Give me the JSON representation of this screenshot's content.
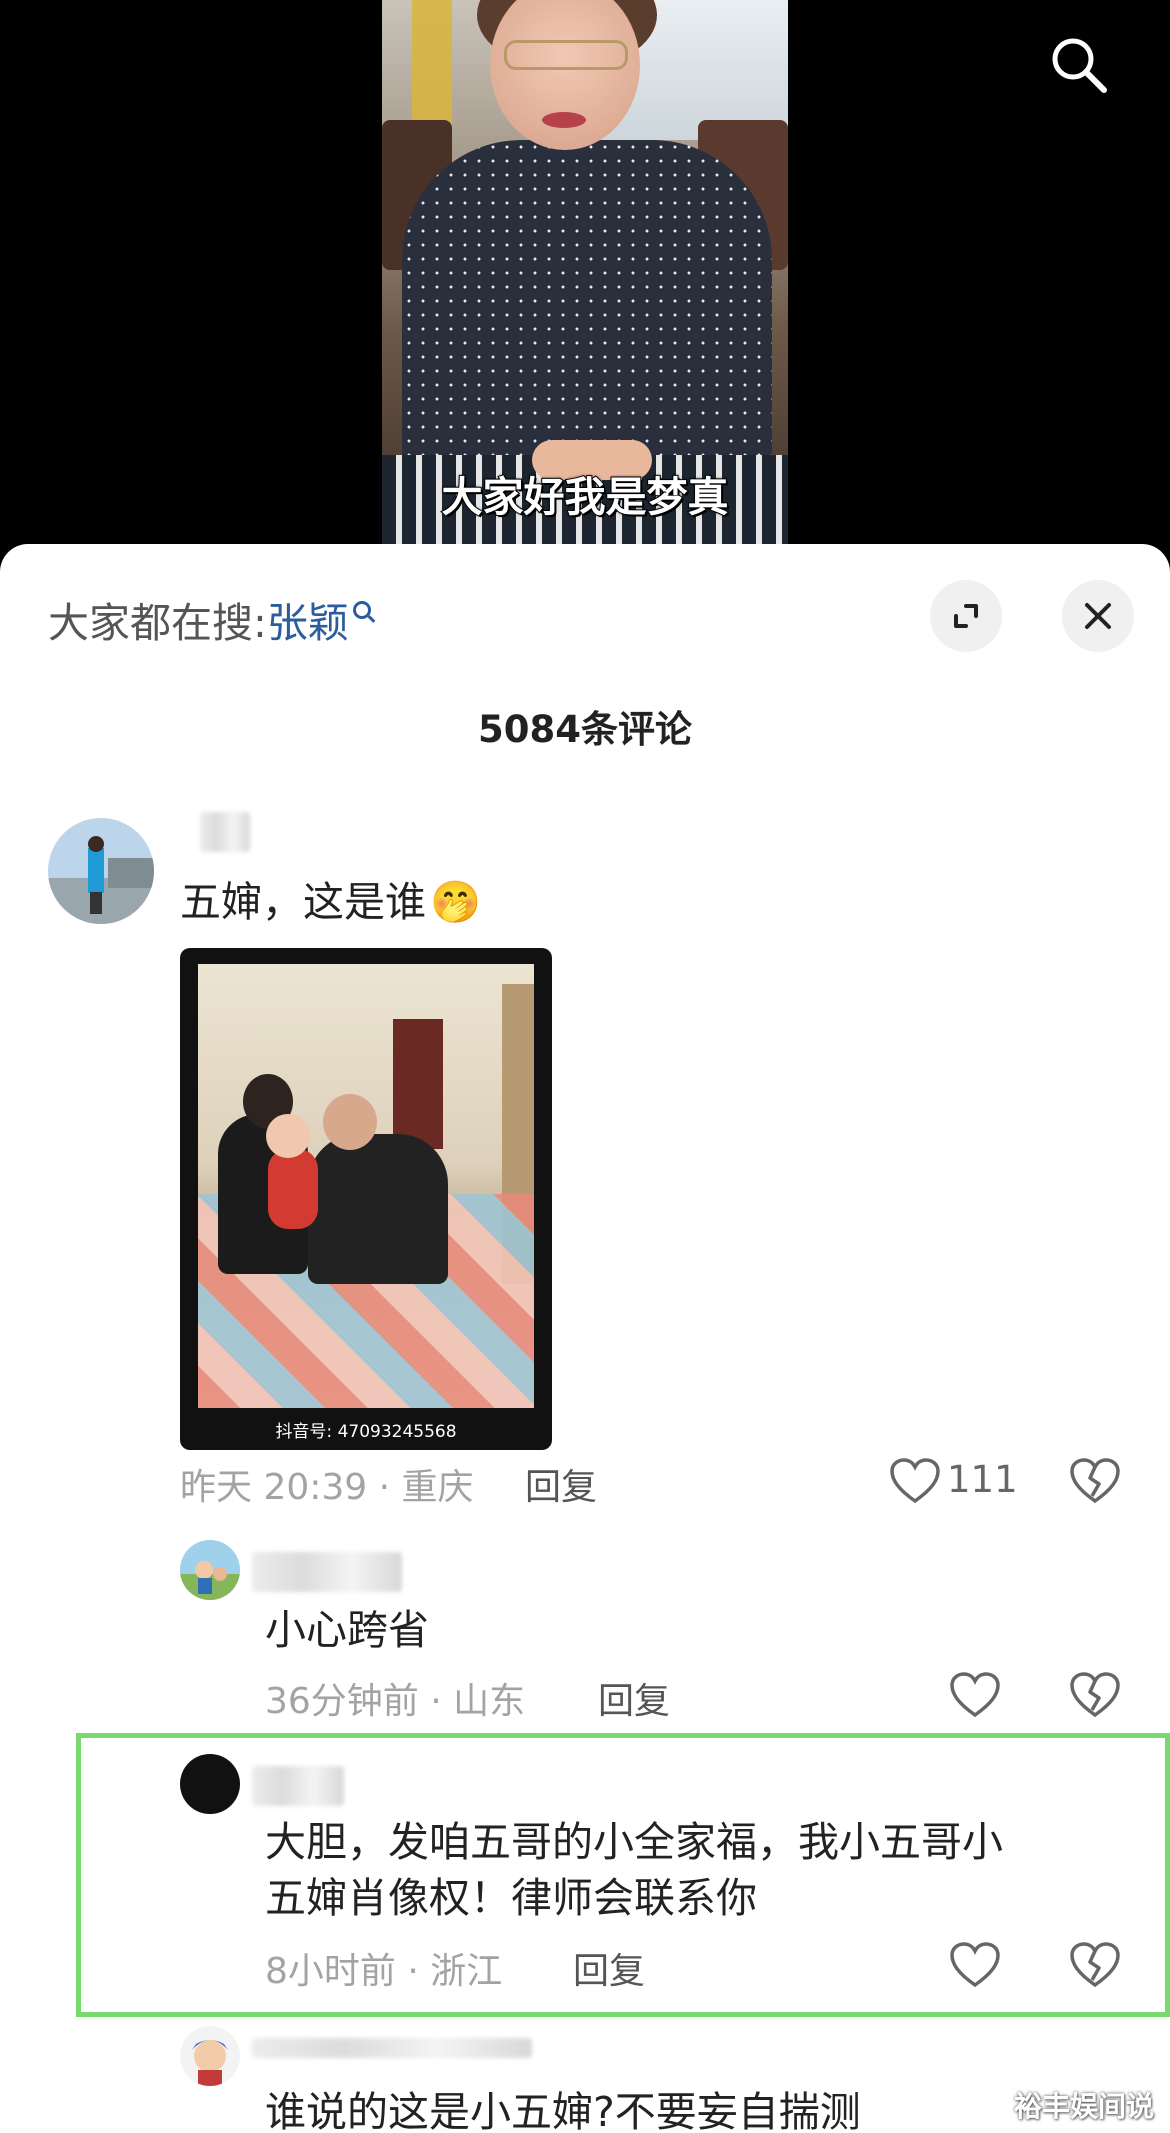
{
  "video": {
    "caption": "大家好我是梦真"
  },
  "search_hint": {
    "prefix": "大家都在搜:",
    "term": "张颖"
  },
  "comments_header": {
    "count_label": "5084条评论"
  },
  "comments": [
    {
      "text": "五婶，这是谁",
      "emoji": "🤭",
      "meta": "昨天 20:39 · 重庆",
      "reply_label": "回复",
      "likes": "111",
      "attachment_watermark": "抖音号: 47093245568"
    },
    {
      "text": "小心跨省",
      "meta": "36分钟前 · 山东",
      "reply_label": "回复"
    },
    {
      "text_line1": "大胆，发咱五哥的小全家福，我小五哥小",
      "text_line2": "五婶肖像权！律师会联系你",
      "meta": "8小时前 · 浙江",
      "reply_label": "回复"
    },
    {
      "text": "谁说的这是小五婶?不要妄自揣测"
    }
  ],
  "corner_watermark": "裕丰娱间说",
  "colors": {
    "highlight": "#7ad96d",
    "search_term": "#2b5d9c"
  }
}
